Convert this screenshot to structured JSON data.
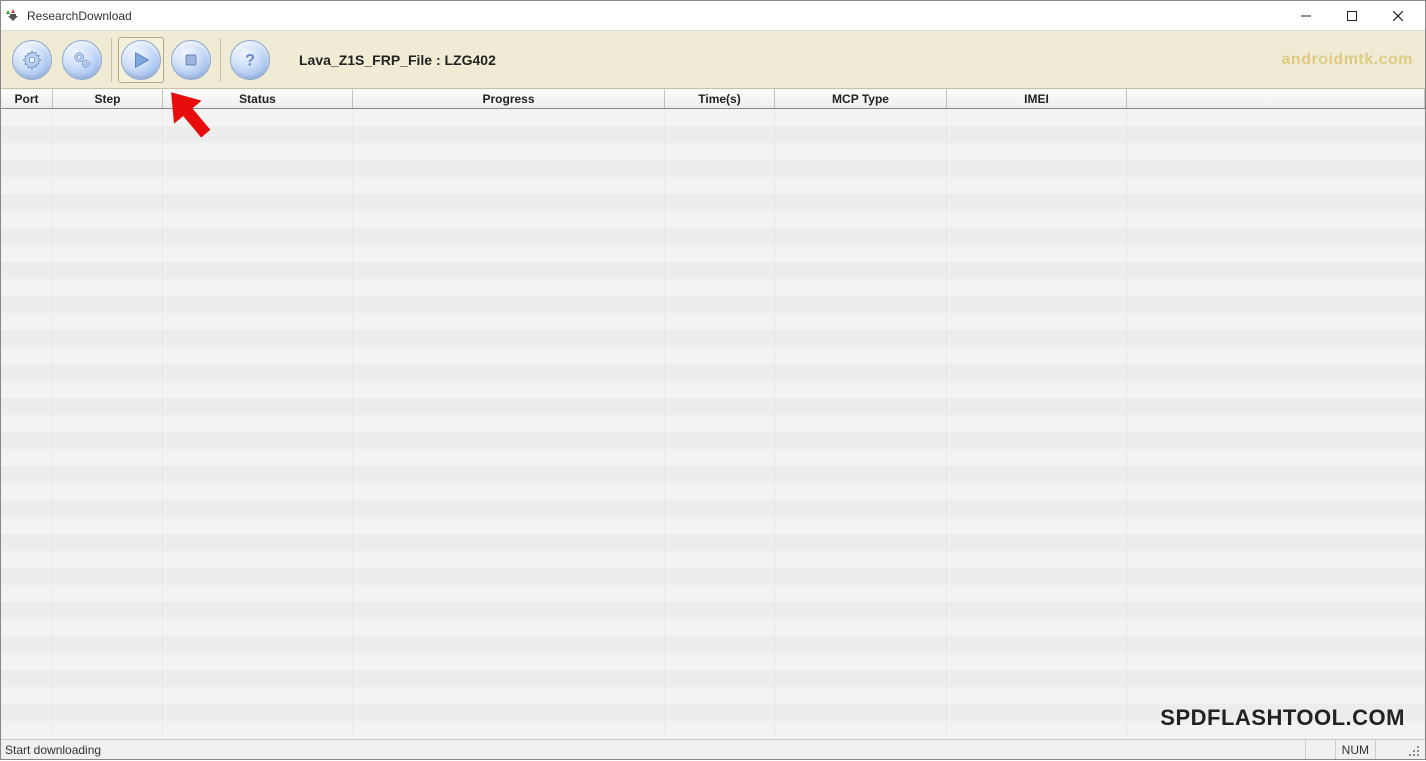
{
  "window": {
    "title": "ResearchDownload"
  },
  "toolbar": {
    "firmware_label": "Lava_Z1S_FRP_File : LZG402",
    "watermark": "androidmtk.com",
    "buttons": {
      "settings": "gear-icon",
      "settings2": "gears-icon",
      "start": "play-icon",
      "stop": "stop-icon",
      "help": "help-icon"
    }
  },
  "columns": {
    "port": "Port",
    "step": "Step",
    "status": "Status",
    "progress": "Progress",
    "times": "Time(s)",
    "mcp": "MCP Type",
    "imei": "IMEI"
  },
  "statusbar": {
    "message": "Start downloading",
    "indicator": "NUM"
  },
  "watermark_bottom": "SPDFLASHTOOL.COM"
}
